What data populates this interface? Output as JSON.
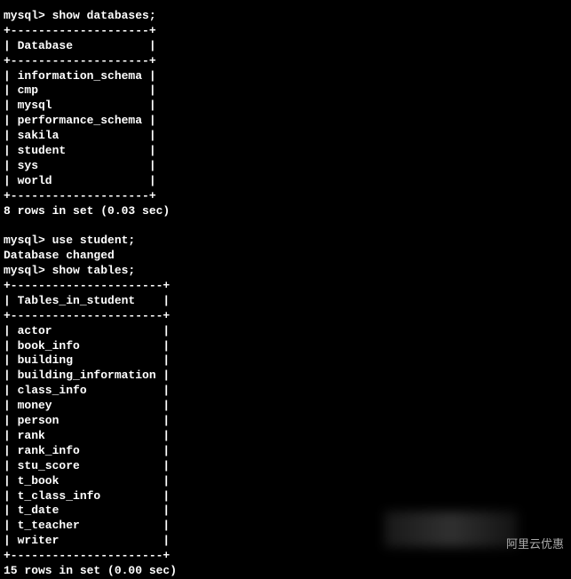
{
  "session": {
    "prompt": "mysql>",
    "cmd1": " show databases;",
    "cmd2": " use student;",
    "cmd2_result": "Database changed",
    "cmd3": " show tables;"
  },
  "table1": {
    "border_top": "+--------------------+",
    "header": "| Database           |",
    "border_mid": "+--------------------+",
    "rows": [
      "| information_schema |",
      "| cmp                |",
      "| mysql              |",
      "| performance_schema |",
      "| sakila             |",
      "| student            |",
      "| sys                |",
      "| world              |"
    ],
    "border_bottom": "+--------------------+",
    "footer": "8 rows in set (0.03 sec)"
  },
  "table2": {
    "border_top": "+----------------------+",
    "header": "| Tables_in_student    |",
    "border_mid": "+----------------------+",
    "rows": [
      "| actor                |",
      "| book_info            |",
      "| building             |",
      "| building_information |",
      "| class_info           |",
      "| money                |",
      "| person               |",
      "| rank                 |",
      "| rank_info            |",
      "| stu_score            |",
      "| t_book               |",
      "| t_class_info         |",
      "| t_date               |",
      "| t_teacher            |",
      "| writer               |"
    ],
    "border_bottom": "+----------------------+",
    "footer": "15 rows in set (0.00 sec)"
  },
  "watermark": "阿里云优惠"
}
